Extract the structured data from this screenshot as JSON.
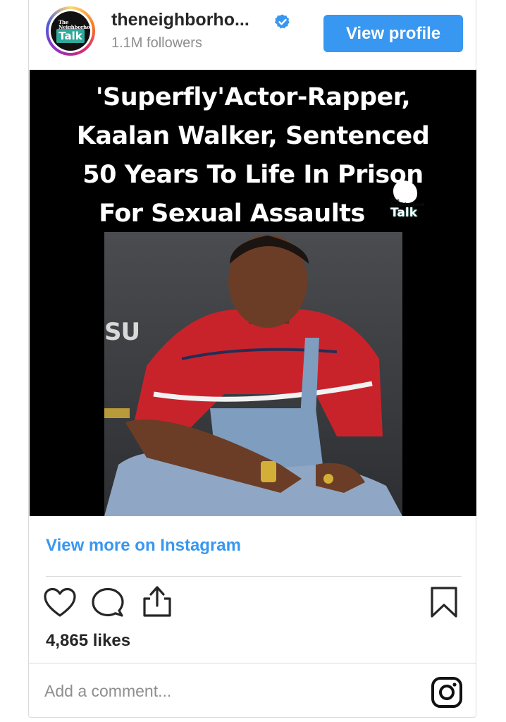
{
  "header": {
    "username": "theneighborho...",
    "followers": "1.1M followers",
    "view_profile_label": "View profile",
    "avatar": {
      "logo_small": "The Neighborhood",
      "logo_talk": "Talk",
      "accent": "#2ea99b"
    },
    "verified_icon": "verified-badge-icon",
    "accent_color": "#3897f0"
  },
  "post": {
    "headline_lines": [
      "'Superfly'Actor-Rapper,",
      "Kaalan Walker, Sentenced",
      "50 Years To Life In Prison",
      "For Sexual Assaults"
    ],
    "watermark": {
      "small": "The Neighborhood",
      "talk": "Talk"
    },
    "photo_wall_text": "SU"
  },
  "footer": {
    "view_more_label": "View more on Instagram",
    "likes": "4,865 likes",
    "comment_placeholder": "Add a comment...",
    "icons": [
      "heart-icon",
      "comment-icon",
      "share-icon",
      "bookmark-icon",
      "instagram-icon"
    ]
  }
}
